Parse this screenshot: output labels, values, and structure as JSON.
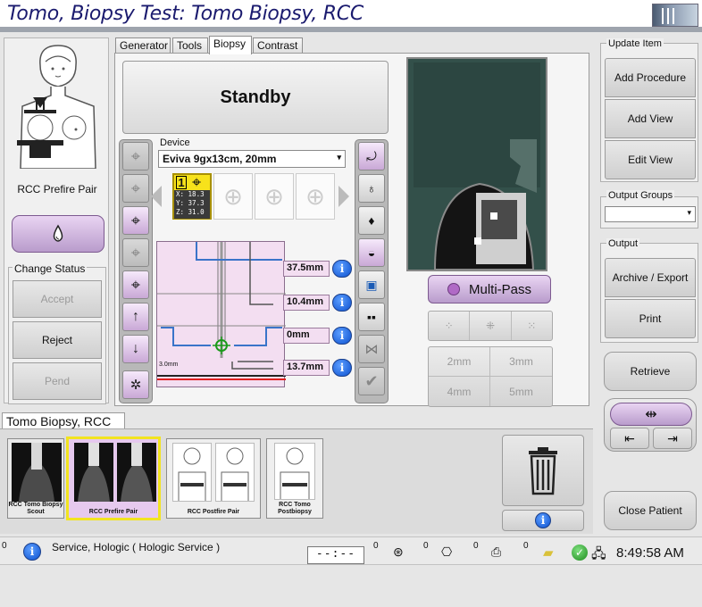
{
  "title": "Tomo, Biopsy Test:  Tomo Biopsy, RCC",
  "patient": {
    "view_label": "RCC Prefire Pair",
    "change_status_label": "Change Status",
    "accept_label": "Accept",
    "reject_label": "Reject",
    "pend_label": "Pend"
  },
  "tabs": [
    {
      "label": "Generator"
    },
    {
      "label": "Tools"
    },
    {
      "label": "Biopsy"
    },
    {
      "label": "Contrast"
    }
  ],
  "biopsy": {
    "status": "Standby",
    "device_label": "Device",
    "device_value": "Eviva 9gx13cm, 20mm",
    "target_number": "1",
    "target_x": "X: 18.3",
    "target_y": "Y: 37.3",
    "target_z": "Z: 31.0",
    "readouts": [
      "37.5mm",
      "10.4mm",
      "0mm",
      "13.7mm"
    ],
    "diagram_scale": "3.0mm",
    "multipass_label": "Multi-Pass",
    "offsets": [
      "2mm",
      "3mm",
      "4mm",
      "5mm"
    ]
  },
  "right": {
    "update_item_label": "Update Item",
    "add_procedure": "Add Procedure",
    "add_view": "Add View",
    "edit_view": "Edit View",
    "output_groups_label": "Output Groups",
    "output_groups_value": "",
    "output_label": "Output",
    "archive_export": "Archive / Export",
    "print": "Print",
    "retrieve": "Retrieve",
    "close_patient": "Close Patient"
  },
  "procedure": {
    "tab_label": "Tomo Biopsy, RCC",
    "thumbnails": [
      {
        "caption": "RCC Tomo Biopsy Scout"
      },
      {
        "caption": "RCC Prefire Pair"
      },
      {
        "caption": "RCC Postfire Pair"
      },
      {
        "caption": "RCC Tomo Postbiopsy"
      }
    ]
  },
  "statusbar": {
    "alarm_count": "0",
    "message": "Service, Hologic ( Hologic Service )",
    "timer": "--:--",
    "counts": [
      "0",
      "0",
      "0",
      "0"
    ],
    "time": "8:49:58 AM"
  },
  "colors": {
    "title_text": "#1a1a6e",
    "accent_purple": "#b99ccc",
    "readout_bg": "#f3def1",
    "target_yellow": "#f7e21b"
  }
}
